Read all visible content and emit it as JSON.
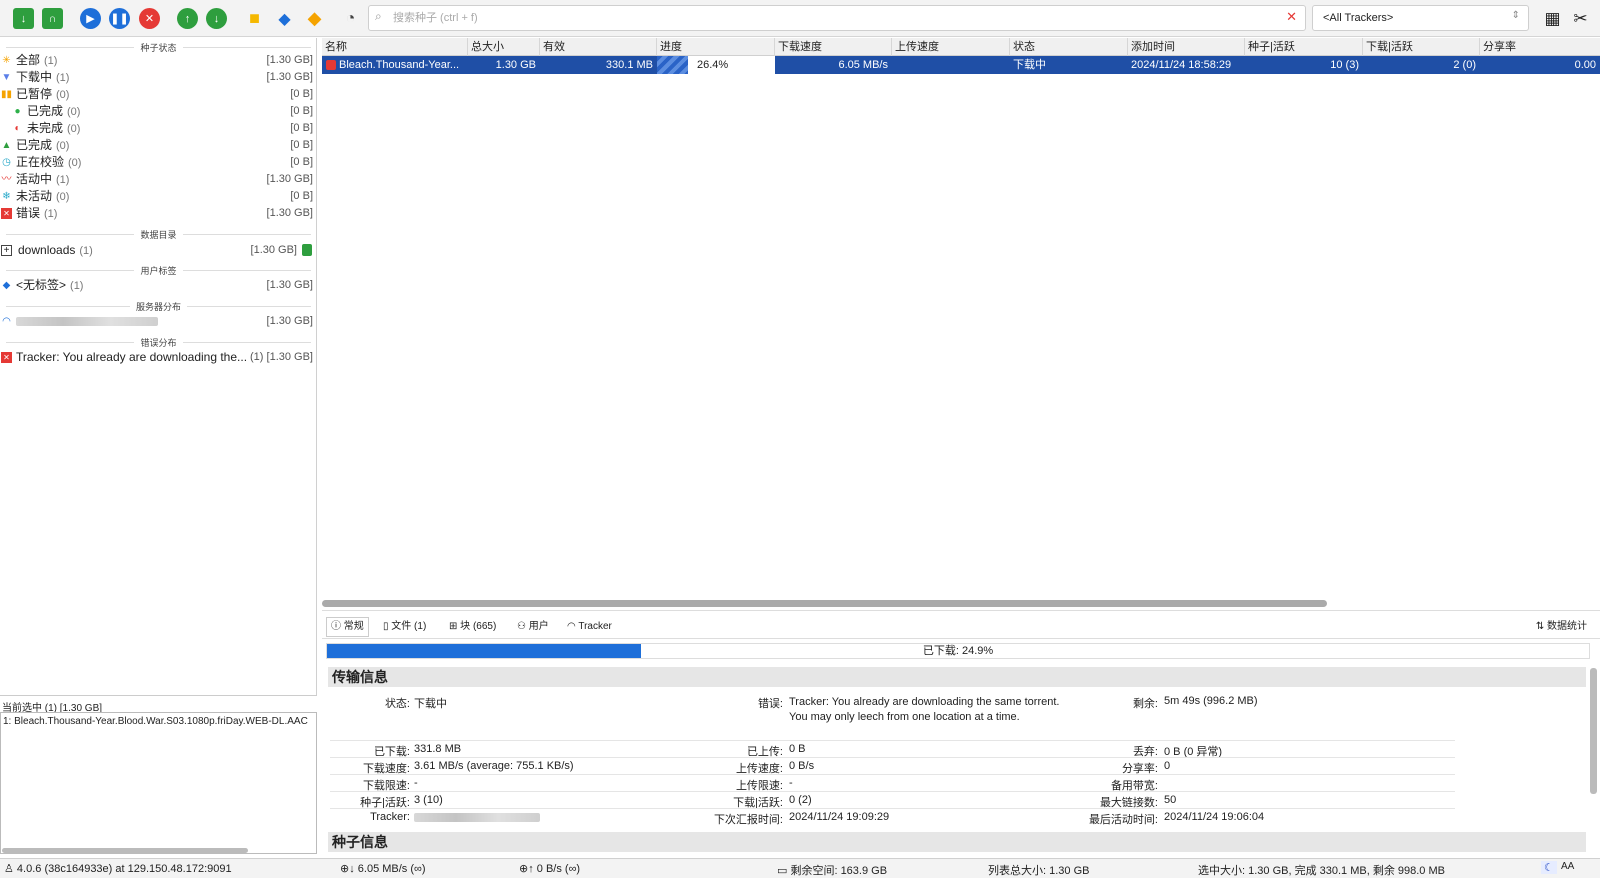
{
  "toolbar": {
    "search_placeholder": "搜索种子 (ctrl + f)",
    "tracker_filter": "<All Trackers>"
  },
  "sidebar": {
    "sections": {
      "status": "种子状态",
      "dirs": "数据目录",
      "tags": "用户标签",
      "servers": "服务器分布",
      "errors": "错误分布"
    },
    "status_items": [
      {
        "label": "全部",
        "count": "(1)",
        "size": "[1.30 GB]"
      },
      {
        "label": "下载中",
        "count": "(1)",
        "size": "[1.30 GB]"
      },
      {
        "label": "已暂停",
        "count": "(0)",
        "size": "[0 B]"
      },
      {
        "label": "已完成",
        "count": "(0)",
        "size": "[0 B]"
      },
      {
        "label": "未完成",
        "count": "(0)",
        "size": "[0 B]"
      },
      {
        "label": "已完成",
        "count": "(0)",
        "size": "[0 B]"
      },
      {
        "label": "正在校验",
        "count": "(0)",
        "size": "[0 B]"
      },
      {
        "label": "活动中",
        "count": "(1)",
        "size": "[1.30 GB]"
      },
      {
        "label": "未活动",
        "count": "(0)",
        "size": "[0 B]"
      },
      {
        "label": "错误",
        "count": "(1)",
        "size": "[1.30 GB]"
      }
    ],
    "dir_item": {
      "label": "downloads",
      "count": "(1)",
      "size": "[1.30 GB]"
    },
    "tag_item": {
      "label": "<无标签>",
      "count": "(1)",
      "size": "[1.30 GB]"
    },
    "server_item": {
      "size": "[1.30 GB]"
    },
    "error_item": {
      "label": "Tracker: You already are downloading the...",
      "count": "(1)",
      "size": "[1.30 GB]"
    },
    "selection_label": "当前选中 (1) [1.30 GB]",
    "selection_item": "1: Bleach.Thousand-Year.Blood.War.S03.1080p.friDay.WEB-DL.AAC"
  },
  "table": {
    "columns": [
      "名称",
      "总大小",
      "有效",
      "进度",
      "下载速度",
      "上传速度",
      "状态",
      "添加时间",
      "种子|活跃",
      "下载|活跃",
      "分享率"
    ],
    "row": {
      "name": "Bleach.Thousand-Year...",
      "total_size": "1.30 GB",
      "valid": "330.1 MB",
      "progress_pct": 26.4,
      "progress": "26.4%",
      "down_speed": "6.05 MB/s",
      "up_speed": "",
      "state": "下载中",
      "added": "2024/11/24 18:58:29",
      "seeds": "10 (3)",
      "peers": "2 (0)",
      "ratio": "0.00"
    }
  },
  "details": {
    "tabs": [
      "常规",
      "文件 (1)",
      "块 (665)",
      "用户",
      "Tracker"
    ],
    "stats_label": "数据统计",
    "downloaded_pct": 24.9,
    "downloaded_label": "已下载: 24.9%",
    "transfer_header": "传输信息",
    "torrent_header": "种子信息",
    "fields": {
      "state_k": "状态:",
      "state_v": "下载中",
      "error_k": "错误:",
      "error_v": "Tracker: You already are downloading the same torrent. You may only leech from one location at a time.",
      "remain_k": "剩余:",
      "remain_v": "5m 49s (996.2 MB)",
      "dl_k": "已下载:",
      "dl_v": "331.8 MB",
      "ul_k": "已上传:",
      "ul_v": "0 B",
      "waste_k": "丢弃:",
      "waste_v": "0 B (0 异常)",
      "dlspeed_k": "下载速度:",
      "dlspeed_v": "3.61 MB/s (average: 755.1 KB/s)",
      "ulspeed_k": "上传速度:",
      "ulspeed_v": "0 B/s",
      "ratio_k": "分享率:",
      "ratio_v": "0",
      "dllimit_k": "下载限速:",
      "dllimit_v": "-",
      "ullimit_k": "上传限速:",
      "ullimit_v": "-",
      "backup_k": "备用带宽:",
      "backup_v": "",
      "seeds_k": "种子|活跃:",
      "seeds_v": "3 (10)",
      "peers_k": "下载|活跃:",
      "peers_v": "0 (2)",
      "maxconn_k": "最大链接数:",
      "maxconn_v": "50",
      "tracker_k": "Tracker:",
      "next_k": "下次汇报时间:",
      "next_v": "2024/11/24 19:09:29",
      "last_k": "最后活动时间:",
      "last_v": "2024/11/24 19:06:04"
    }
  },
  "status_bar": {
    "version": "4.0.6 (38c164933e) at 129.150.48.172:9091",
    "down": "6.05 MB/s (∞)",
    "up": "0 B/s (∞)",
    "free_space": "剩余空间: 163.9 GB",
    "list_size": "列表总大小: 1.30 GB",
    "selected": "选中大小: 1.30 GB, 完成 330.1 MB, 剩余 998.0 MB",
    "font_toggle": "AA"
  }
}
